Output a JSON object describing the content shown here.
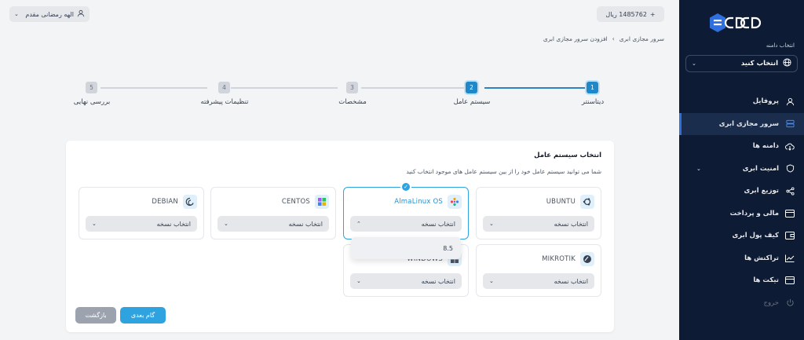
{
  "sidebar": {
    "domain_label": "انتخاب دامنه",
    "domain_select": "انتخاب کنید",
    "items": [
      {
        "label": "پروفایل",
        "icon": "user-icon"
      },
      {
        "label": "سرور مجازی ابری",
        "icon": "server-icon",
        "active": true
      },
      {
        "label": "دامنه ها",
        "icon": "cloud-icon"
      },
      {
        "label": "امنیت ابری",
        "icon": "shield-icon",
        "has_chevron": true
      },
      {
        "label": "توزیع ابری",
        "icon": "share-icon"
      },
      {
        "label": "مالی و پرداخت",
        "icon": "card-icon"
      },
      {
        "label": "کیف پول ابری",
        "icon": "wallet-icon"
      },
      {
        "label": "تراکنش ها",
        "icon": "chart-icon"
      },
      {
        "label": "تیکت ها",
        "icon": "ticket-icon"
      },
      {
        "label": "خروج",
        "icon": "power-icon",
        "muted": true
      }
    ]
  },
  "topbar": {
    "balance": "1485762 ریال",
    "balance_plus": "+",
    "user_name": "الهه رمضانی مقدم"
  },
  "breadcrumb": {
    "parent": "سرور مجازی ابری",
    "separator": "›",
    "current": "افزودن سرور مجازی ابری"
  },
  "stepper": [
    {
      "num": "1",
      "label": "دیتاسنتر",
      "active": true
    },
    {
      "num": "2",
      "label": "سیستم عامل",
      "active": true
    },
    {
      "num": "3",
      "label": "مشخصات"
    },
    {
      "num": "4",
      "label": "تنظیمات پیشرفته"
    },
    {
      "num": "5",
      "label": "بررسی نهایی"
    }
  ],
  "card": {
    "title": "انتخاب سیستم عامل",
    "subtitle": "شما می توانید سیستم عامل خود را از بین سیستم عامل های موجود انتخاب کنید"
  },
  "os_options": {
    "ubuntu": {
      "name": "UBUNTU",
      "select": "انتخاب نسخه"
    },
    "alma": {
      "name": "AlmaLinux OS",
      "select": "انتخاب نسخه"
    },
    "centos": {
      "name": "CENTOS",
      "select": "انتخاب نسخه"
    },
    "debian": {
      "name": "DEBIAN",
      "select": "انتخاب نسخه"
    },
    "mikrotik": {
      "name": "MIKROTIK",
      "select": "انتخاب نسخه"
    },
    "windows": {
      "name": "WINDOWS",
      "select": "انتخاب نسخه"
    }
  },
  "dropdown": {
    "option": "8.5"
  },
  "buttons": {
    "next": "گام بعدی",
    "back": "بازگشت"
  },
  "colors": {
    "accent": "#2fa3e0",
    "sidebar": "#0e1b34"
  }
}
